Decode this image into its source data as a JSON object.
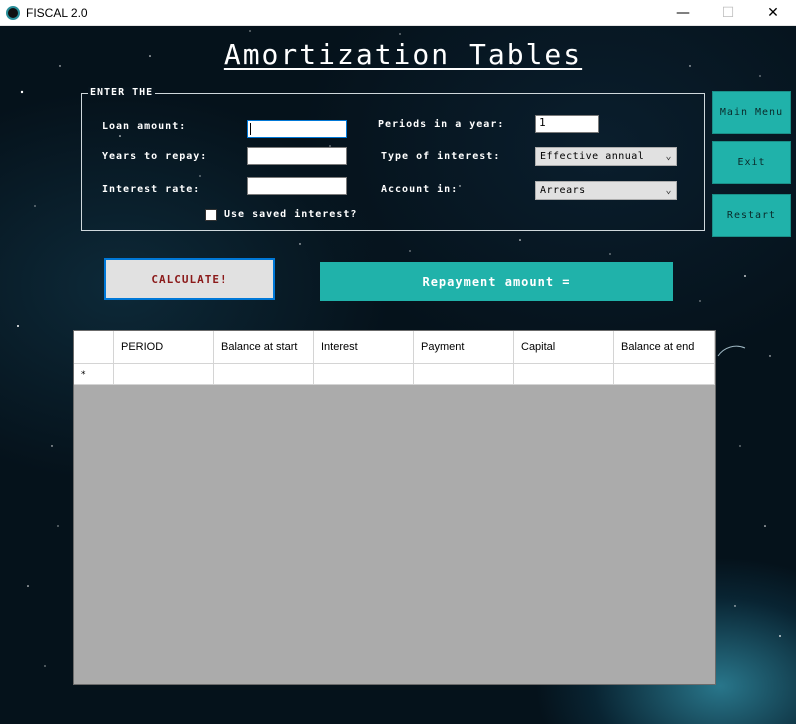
{
  "window": {
    "title": "FISCAL 2.0",
    "minimize_glyph": "—",
    "maximize_glyph": "☐",
    "close_glyph": "✕"
  },
  "page": {
    "title": "Amortization Tables"
  },
  "form": {
    "legend": "ENTER THE",
    "loan_amount_label": "Loan amount:",
    "loan_amount_value": "",
    "years_label": "Years to repay:",
    "years_value": "",
    "interest_rate_label": "Interest rate:",
    "interest_rate_value": "",
    "periods_label": "Periods in a year:",
    "periods_value": "1",
    "type_label": "Type of interest:",
    "type_value": "Effective annual",
    "account_label": "Account in:",
    "account_value": "Arrears",
    "use_saved_label": "Use saved interest?",
    "use_saved_checked": false
  },
  "side_menu": {
    "main_menu": "Main Menu",
    "exit": "Exit",
    "restart": "Restart"
  },
  "actions": {
    "calculate": "CALCULATE!",
    "repayment": "Repayment amount ="
  },
  "grid": {
    "columns": [
      "PERIOD",
      "Balance at start",
      "Interest",
      "Payment",
      "Capital",
      "Balance at end"
    ],
    "new_row_marker": "*"
  },
  "colors": {
    "accent": "#20b2aa",
    "calculate_text": "#8b1a1a",
    "focus": "#0078d7"
  }
}
